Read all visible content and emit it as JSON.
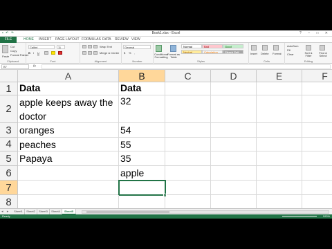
{
  "window": {
    "title": "Book1.xlsx - Excel",
    "qat_icons": [
      "save-icon",
      "undo-icon",
      "redo-icon"
    ],
    "window_controls": [
      "?",
      "–",
      "□",
      "✕"
    ]
  },
  "ribbon_tabs": [
    "FILE",
    "HOME",
    "INSERT",
    "PAGE LAYOUT",
    "FORMULAS",
    "DATA",
    "REVIEW",
    "VIEW"
  ],
  "ribbon": {
    "clipboard": {
      "label": "Clipboard",
      "paste": "Paste",
      "cut": "Cut",
      "copy": "Copy",
      "format_painter": "Format Painter"
    },
    "font": {
      "label": "Font",
      "name": "Calibri",
      "size": "11",
      "bold": "B",
      "italic": "I",
      "underline": "U"
    },
    "alignment": {
      "label": "Alignment",
      "wrap_text": "Wrap Text",
      "merge_center": "Merge & Center"
    },
    "number": {
      "label": "Number",
      "format": "General",
      "currency": "$",
      "percent": "%",
      "comma": ","
    },
    "styles": {
      "label": "Styles",
      "conditional": "Conditional Formatting",
      "format_table": "Format as Table",
      "normal": "Normal",
      "bad": "Bad",
      "good": "Good",
      "neutral": "Neutral",
      "calculation": "Calculation",
      "check_cell": "Check Cell"
    },
    "cells": {
      "label": "Cells",
      "insert": "Insert",
      "delete": "Delete",
      "format": "Format"
    },
    "editing": {
      "label": "Editing",
      "autosum": "AutoSum",
      "fill": "Fill",
      "clear": "Clear",
      "sort": "Sort & Filter",
      "find": "Find & Select"
    }
  },
  "formula_bar": {
    "name_box": "B7",
    "fx": "fx",
    "value": ""
  },
  "columns": [
    "A",
    "B",
    "C",
    "D",
    "E",
    "F"
  ],
  "selected_column": "B",
  "rows": [
    {
      "num": "1",
      "a": "Data",
      "b": "Data"
    },
    {
      "num": "2",
      "a": "apple keeps away the doctor",
      "b": "32"
    },
    {
      "num": "3",
      "a": "oranges",
      "b": "54"
    },
    {
      "num": "4",
      "a": "peaches",
      "b": "55"
    },
    {
      "num": "5",
      "a": "Papaya",
      "b": "35"
    },
    {
      "num": "6",
      "a": "",
      "b": "apple"
    },
    {
      "num": "7",
      "a": "",
      "b": ""
    },
    {
      "num": "8",
      "a": "",
      "b": ""
    }
  ],
  "selected_row": "7",
  "sheets": [
    "Sheet1",
    "Sheet2",
    "Sheet3",
    "Sheet4",
    "Sheet5"
  ],
  "active_sheet": "Sheet5",
  "status": {
    "ready": "Ready",
    "zoom": "100%"
  }
}
